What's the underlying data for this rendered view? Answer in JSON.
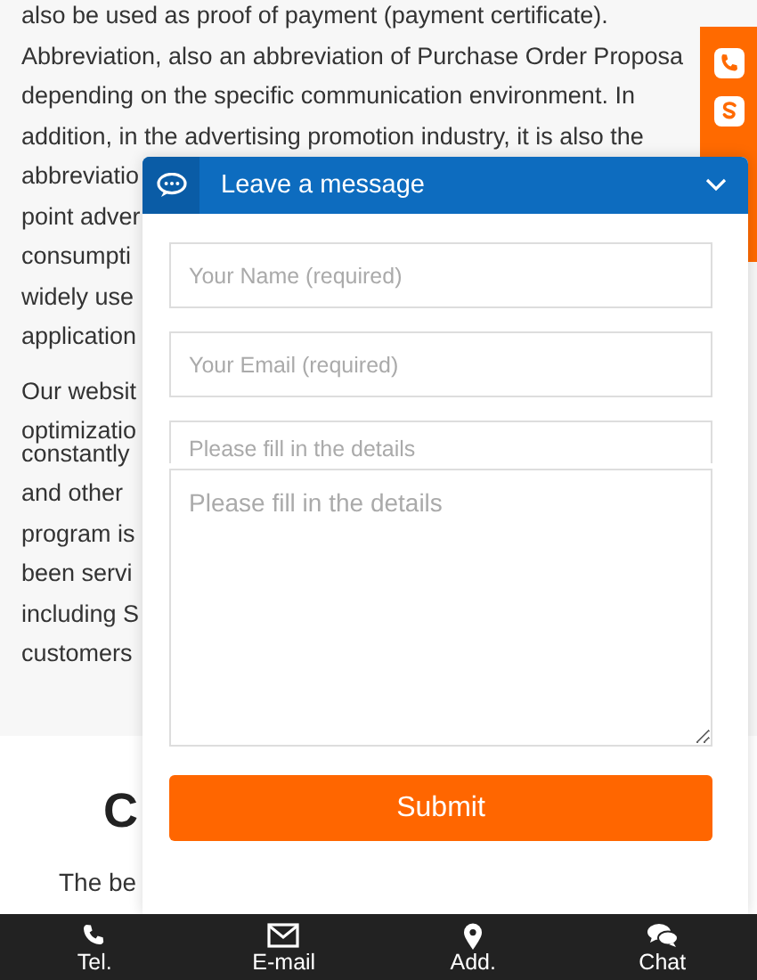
{
  "article": {
    "paragraphs": [
      [
        "also be used as proof of payment (payment certificate).",
        "Abbreviation, also an abbreviation of Purchase Order Proposa",
        "depending on the specific communication environment.  In",
        "addition, in the advertising promotion industry, it is also the",
        "abbreviatio",
        "point adver",
        "consumpti",
        "widely use",
        "application"
      ],
      [
        "Our websit",
        "optimizatio",
        "constantly",
        "and other",
        "program is",
        "been servi",
        "including S",
        "customers"
      ]
    ]
  },
  "section": {
    "heading": "C",
    "intro": "The be"
  },
  "chat": {
    "title": "Leave a message",
    "fields": [
      {
        "kind": "input",
        "placeholder": "Your Name (required)"
      },
      {
        "kind": "input",
        "placeholder": "Your Email (required)"
      },
      {
        "kind": "input",
        "placeholder": "Please fill in the details"
      },
      {
        "kind": "textarea",
        "placeholder": "Please fill in the details"
      }
    ],
    "submit": "Submit"
  },
  "bottom_nav": [
    {
      "label": "Tel."
    },
    {
      "label": "E-mail"
    },
    {
      "label": "Add."
    },
    {
      "label": "Chat"
    }
  ]
}
